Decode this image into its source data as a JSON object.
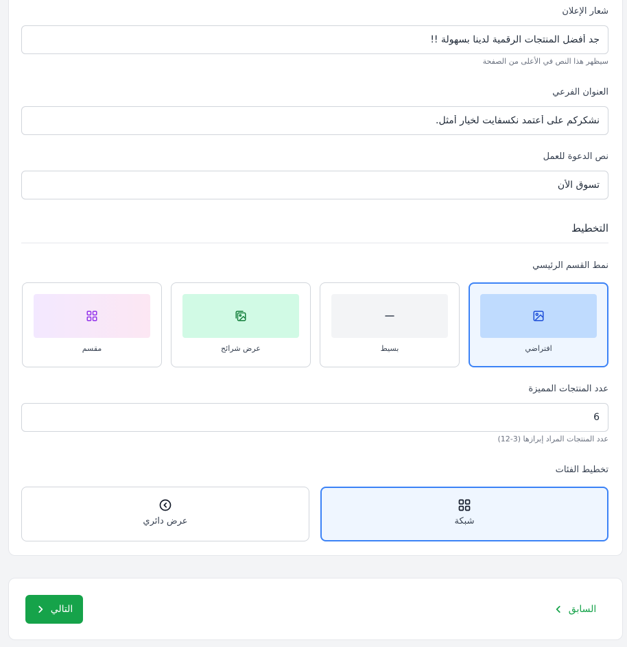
{
  "slogan": {
    "label": "شعار الإعلان",
    "value": "جد أفضل المنتجات الرقمية لدينا بسهولة !!",
    "hint": "سيظهر هذا النص في الأعلى من الصفحة"
  },
  "subtitle": {
    "label": "العنوان الفرعي",
    "value": "نشكركم على أعتمد نكسفايت لخيار أمثل."
  },
  "cta": {
    "label": "نص الدعوة للعمل",
    "value": "تسوق الأن"
  },
  "layout": {
    "section_title": "التخطيط",
    "hero_style_label": "نمط القسم الرئيسي",
    "hero_styles": [
      {
        "label": "افتراضي",
        "icon": "image-icon",
        "color": "#bfdbfe",
        "selected": true
      },
      {
        "label": "بسيط",
        "icon": "minus-icon",
        "color": "#f3f4f6",
        "selected": false
      },
      {
        "label": "عرض شرائح",
        "icon": "images-icon",
        "color": "#d1fae5",
        "selected": false
      },
      {
        "label": "مقسم",
        "icon": "grid-icon",
        "color": "#f3e8ff",
        "selected": false
      }
    ],
    "featured_count": {
      "label": "عدد المنتجات المميزة",
      "value": "6",
      "hint": "عدد المنتجات المراد إبرازها (3-12)"
    },
    "category_layout_label": "تخطيط الفئات",
    "category_layouts": [
      {
        "label": "شبكة",
        "icon": "grid-icon",
        "selected": true
      },
      {
        "label": "عرض دائري",
        "icon": "circle-chevron-left-icon",
        "selected": false
      }
    ]
  },
  "footer": {
    "next_label": "التالي",
    "prev_label": "السابق"
  },
  "colors": {
    "accent": "#16a34a",
    "selected_border": "#3b82f6",
    "selected_bg": "#eff6ff"
  }
}
